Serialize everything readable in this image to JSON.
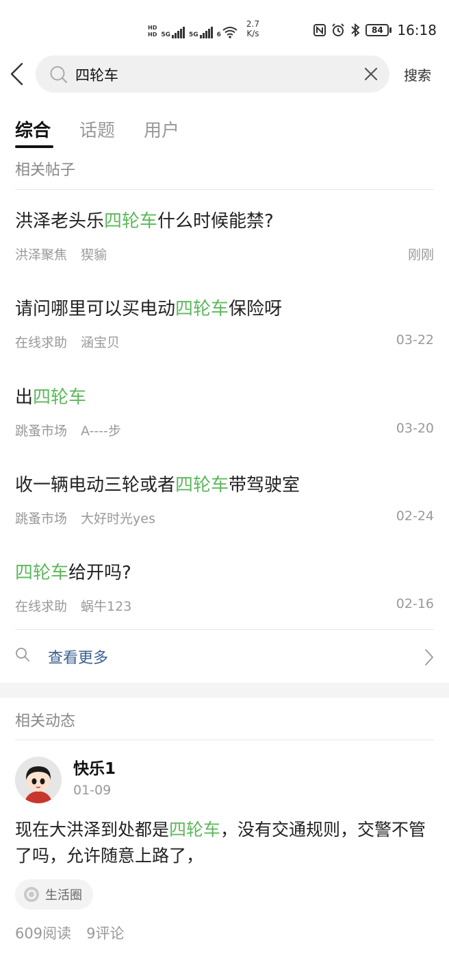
{
  "status_bar": {
    "net_speed_value": "2.7",
    "net_speed_unit": "K/s",
    "network_labels": [
      "HD",
      "5G",
      "5G",
      "6"
    ],
    "battery": "84",
    "time": "16:18"
  },
  "search": {
    "query": "四轮车",
    "submit_label": "搜索"
  },
  "tabs": [
    {
      "label": "综合",
      "active": true
    },
    {
      "label": "话题",
      "active": false
    },
    {
      "label": "用户",
      "active": false
    }
  ],
  "posts_section_title": "相关帖子",
  "posts": [
    {
      "title_pre": "洪泽老头乐",
      "title_hl": "四轮车",
      "title_post": "什么时候能禁?",
      "forum": "洪泽聚焦",
      "author": "猰貐",
      "date": "刚刚"
    },
    {
      "title_pre": "请问哪里可以买电动",
      "title_hl": "四轮车",
      "title_post": "保险呀",
      "forum": "在线求助",
      "author": "涵宝贝",
      "date": "03-22"
    },
    {
      "title_pre": "出",
      "title_hl": "四轮车",
      "title_post": "",
      "forum": "跳蚤市场",
      "author": "A----步",
      "date": "03-20"
    },
    {
      "title_pre": "收一辆电动三轮或者",
      "title_hl": "四轮车",
      "title_post": "带驾驶室",
      "forum": "跳蚤市场",
      "author": "大好时光yes",
      "date": "02-24"
    },
    {
      "title_pre": "",
      "title_hl": "四轮车",
      "title_post": "给开吗?",
      "forum": "在线求助",
      "author": "蜗牛123",
      "date": "02-16"
    }
  ],
  "see_more_label": "查看更多",
  "feed_section_title": "相关动态",
  "feed": {
    "user_name": "快乐1",
    "date": "01-09",
    "text_pre": "现在大洪泽到处都是",
    "text_hl": "四轮车",
    "text_post": "，没有交通规则，交警不管了吗，允许随意上路了，",
    "tag": "生活圈",
    "reads": "609阅读",
    "comments": "9评论"
  },
  "colors": {
    "highlight": "#5cb85c",
    "link": "#3a5f8f"
  }
}
